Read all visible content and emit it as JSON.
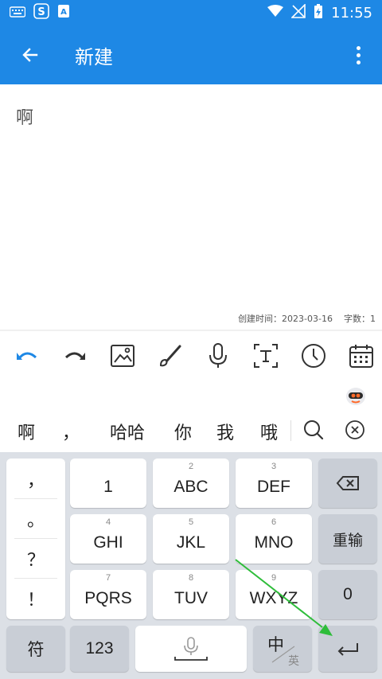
{
  "status": {
    "time": "11:55"
  },
  "appbar": {
    "title": "新建",
    "back_icon": "arrow-left-icon",
    "menu_icon": "more-vertical-icon"
  },
  "editor": {
    "content": "啊",
    "created_label": "创建时间：2023-03-16",
    "count_label": "字数：1"
  },
  "toolbar": {
    "tools": [
      "undo-icon",
      "redo-icon",
      "image-icon",
      "brush-icon",
      "microphone-icon",
      "text-box-icon",
      "clock-icon",
      "calendar-icon"
    ]
  },
  "ime": {
    "candidates": [
      "啊",
      "，",
      "哈哈",
      "你",
      "我",
      "哦"
    ]
  },
  "keyboard": {
    "punct": [
      "，",
      "。",
      "？",
      "！"
    ],
    "keys": [
      {
        "sub": "",
        "main": "1"
      },
      {
        "sub": "2",
        "main": "ABC"
      },
      {
        "sub": "3",
        "main": "DEF"
      },
      {
        "sub": "4",
        "main": "GHI"
      },
      {
        "sub": "5",
        "main": "JKL"
      },
      {
        "sub": "6",
        "main": "MNO"
      },
      {
        "sub": "7",
        "main": "PQRS"
      },
      {
        "sub": "8",
        "main": "TUV"
      },
      {
        "sub": "9",
        "main": "WXYZ"
      }
    ],
    "reenter": "重输",
    "zero": "0",
    "symbols": "符",
    "numbers": "123",
    "lang_main": "中",
    "lang_sub": "英"
  },
  "colors": {
    "accent": "#1E88E5",
    "arrow": "#2EBD3A"
  }
}
